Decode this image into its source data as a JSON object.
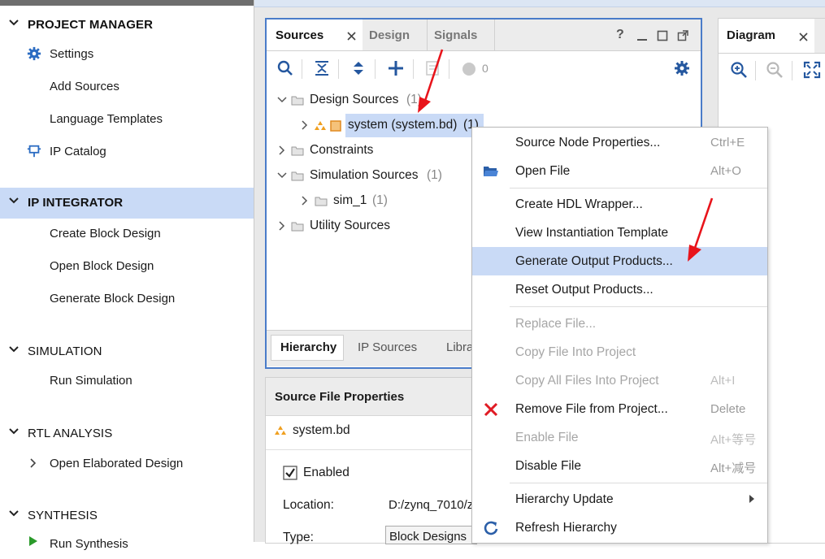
{
  "flow": {
    "sections": [
      {
        "label": "PROJECT MANAGER",
        "bold": true
      },
      {
        "label": "IP INTEGRATOR",
        "bold": true
      },
      {
        "label": "SIMULATION",
        "bold": false
      },
      {
        "label": "RTL ANALYSIS",
        "bold": false
      },
      {
        "label": "SYNTHESIS",
        "bold": false
      }
    ],
    "pm_items": [
      "Settings",
      "Add Sources",
      "Language Templates",
      "IP Catalog"
    ],
    "ipi_items": [
      "Create Block Design",
      "Open Block Design",
      "Generate Block Design"
    ],
    "sim_items": [
      "Run Simulation"
    ],
    "rtl_items": [
      "Open Elaborated Design"
    ],
    "syn_items": [
      "Run Synthesis"
    ]
  },
  "sources": {
    "tabs": [
      "Sources",
      "Design",
      "Signals"
    ],
    "toolbar_badge": "0",
    "tree": [
      {
        "label": "Design Sources",
        "count": "(1)"
      },
      {
        "label": "system (system.bd)",
        "count": "(1)"
      },
      {
        "label": "Constraints",
        "count": ""
      },
      {
        "label": "Simulation Sources",
        "count": "(1)"
      },
      {
        "label": "sim_1",
        "count": "(1)"
      },
      {
        "label": "Utility Sources",
        "count": ""
      }
    ],
    "bottom_tabs": [
      "Hierarchy",
      "IP Sources",
      "Libra"
    ]
  },
  "props": {
    "title": "Source File Properties",
    "file": "system.bd",
    "enabled_label": "Enabled",
    "location_label": "Location:",
    "location_value": "D:/zynq_7010/z",
    "type_label": "Type:",
    "type_value": "Block Designs"
  },
  "diagram": {
    "tab": "Diagram"
  },
  "menu": {
    "items": [
      {
        "label": "Source Node Properties...",
        "shortcut": "Ctrl+E",
        "disabled": false
      },
      {
        "label": "Open File",
        "shortcut": "Alt+O",
        "disabled": false
      },
      {
        "label": "Create HDL Wrapper...",
        "shortcut": "",
        "disabled": false
      },
      {
        "label": "View Instantiation Template",
        "shortcut": "",
        "disabled": false
      },
      {
        "label": "Generate Output Products...",
        "shortcut": "",
        "disabled": false
      },
      {
        "label": "Reset Output Products...",
        "shortcut": "",
        "disabled": false
      },
      {
        "label": "Replace File...",
        "shortcut": "",
        "disabled": true
      },
      {
        "label": "Copy File Into Project",
        "shortcut": "",
        "disabled": true
      },
      {
        "label": "Copy All Files Into Project",
        "shortcut": "Alt+I",
        "disabled": true
      },
      {
        "label": "Remove File from Project...",
        "shortcut": "Delete",
        "disabled": false
      },
      {
        "label": "Enable File",
        "shortcut": "Alt+等号",
        "disabled": true
      },
      {
        "label": "Disable File",
        "shortcut": "Alt+减号",
        "disabled": false
      },
      {
        "label": "Hierarchy Update",
        "shortcut": "",
        "disabled": false
      },
      {
        "label": "Refresh Hierarchy",
        "shortcut": "",
        "disabled": false
      }
    ]
  },
  "colors": {
    "accent": "#4a7cc9",
    "selected": "#c9daf6",
    "annotation": "#e8141b"
  }
}
